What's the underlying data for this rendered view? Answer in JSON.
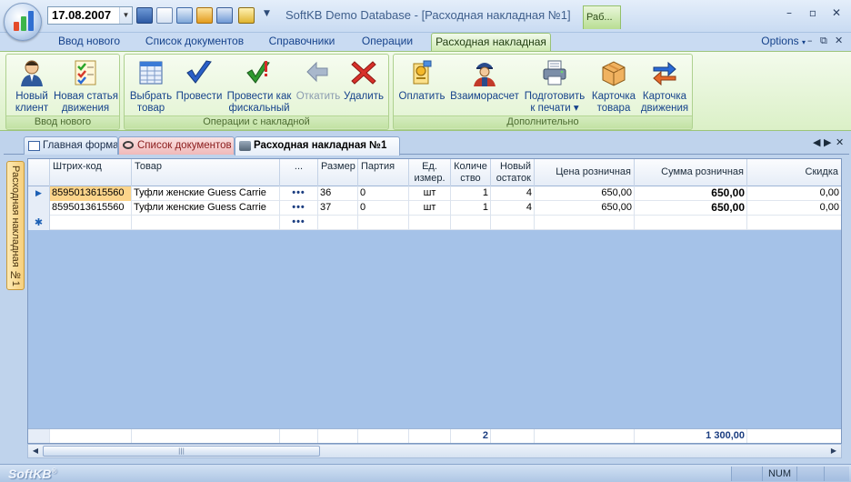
{
  "titlebar": {
    "date": "17.08.2007",
    "title": "SoftKB Demo Database - [Расходная накладная №1]",
    "context_tab_label": "Раб..."
  },
  "ribbon_tabs": [
    "Ввод нового",
    "Список документов",
    "Справочники",
    "Операции",
    "Расходная накладная"
  ],
  "active_ribbon_tab": "Расходная накладная",
  "options_label": "Options",
  "groups": {
    "vvod": {
      "label": "Ввод нового",
      "buttons": [
        {
          "label1": "Новый",
          "label2": "клиент",
          "icon": "person-icon"
        },
        {
          "label1": "Новая статья",
          "label2": "движения",
          "icon": "checklist-icon"
        }
      ]
    },
    "operations": {
      "label": "Операции с накладной",
      "buttons": [
        {
          "label1": "Выбрать",
          "label2": "товар",
          "icon": "table-icon"
        },
        {
          "label1": "Провести",
          "label2": "",
          "icon": "checkmark-icon"
        },
        {
          "label1": "Провести как",
          "label2": "фискальный",
          "icon": "fiscal-check-icon"
        },
        {
          "label1": "Откатить",
          "label2": "",
          "icon": "undo-icon"
        },
        {
          "label1": "Удалить",
          "label2": "",
          "icon": "delete-icon"
        }
      ]
    },
    "extra": {
      "label": "Дополнительно",
      "buttons": [
        {
          "label1": "Оплатить",
          "label2": "",
          "icon": "payment-icon"
        },
        {
          "label1": "Взаиморасчет",
          "label2": "",
          "icon": "worker-icon"
        },
        {
          "label1": "Подготовить",
          "label2": "к печати ▾",
          "icon": "printer-icon"
        },
        {
          "label1": "Карточка",
          "label2": "товара",
          "icon": "box-icon"
        },
        {
          "label1": "Карточка",
          "label2": "движения",
          "icon": "arrows-icon"
        }
      ]
    }
  },
  "doc_tabs": [
    "Главная форма",
    "Список документов",
    "Расходная накладная №1"
  ],
  "side_tab": "Расходная накладная №1",
  "grid": {
    "columns": [
      "Штрих-код",
      "Товар",
      "...",
      "Размер",
      "Партия",
      "Ед. измер.",
      "Количе ство",
      "Новый остаток",
      "Цена розничная",
      "Сумма розничная",
      "Скидка"
    ],
    "rows": [
      {
        "barcode": "8595013615560",
        "product": "Туфли женские Guess Carrie",
        "dots": "•••",
        "size": "36",
        "batch": "0",
        "unit": "шт",
        "qty": "1",
        "rest": "4",
        "price": "650,00",
        "sum": "650,00",
        "discount": "0,00"
      },
      {
        "barcode": "8595013615560",
        "product": "Туфли женские Guess Carrie",
        "dots": "•••",
        "size": "37",
        "batch": "0",
        "unit": "шт",
        "qty": "1",
        "rest": "4",
        "price": "650,00",
        "sum": "650,00",
        "discount": "0,00"
      }
    ],
    "new_row_dots": "•••",
    "totals": {
      "qty": "2",
      "sum": "1 300,00"
    }
  },
  "status": {
    "brand": "SoftKB",
    "num": "NUM"
  }
}
